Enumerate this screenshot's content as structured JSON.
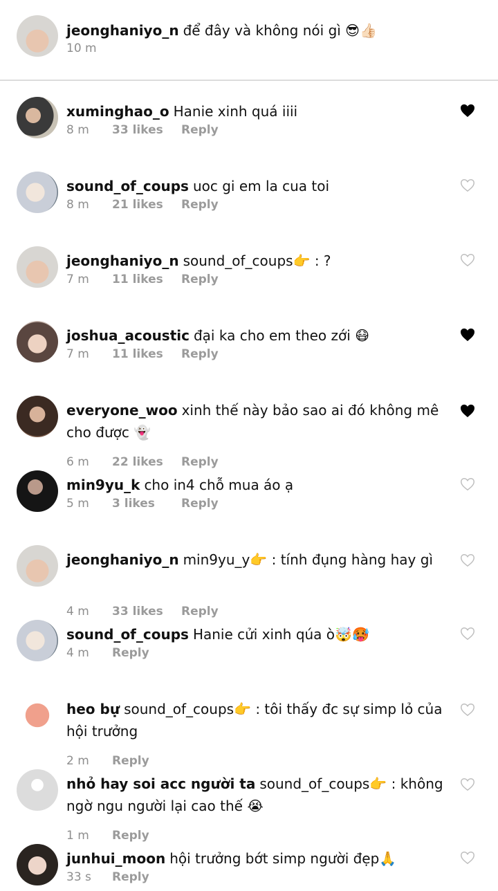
{
  "caption": {
    "username": "jeonghaniyo_n",
    "text": "để đây và không nói gì 😎👍🏻",
    "time": "10 m"
  },
  "colors": {
    "heart_filled": "#000000",
    "heart_outline": "#bdbdbd",
    "meta": "#9b9b9b",
    "divider": "#dcdcdc"
  },
  "comments": [
    {
      "username": "xuminghao_o",
      "text": "Hanie xinh quá iiii",
      "time": "8 m",
      "likes": "33 likes",
      "reply": "Reply",
      "liked": true,
      "avatar": "avatar-xuminghao"
    },
    {
      "username": "sound_of_coups",
      "text": "uoc gi em la cua toi",
      "time": "8 m",
      "likes": "21 likes",
      "reply": "Reply",
      "liked": false,
      "avatar": "avatar-sound"
    },
    {
      "username": "jeonghaniyo_n",
      "text": "sound_of_coups👉 : ?",
      "time": "7 m",
      "likes": "11 likes",
      "reply": "Reply",
      "liked": false,
      "avatar": "avatar-jeonghan"
    },
    {
      "username": "joshua_acoustic",
      "text": "đại ka cho em theo zới 😷",
      "time": "7 m",
      "likes": "11 likes",
      "reply": "Reply",
      "liked": true,
      "avatar": "avatar-joshua"
    },
    {
      "username": "everyone_woo",
      "text": "xinh thế này bảo sao ai đó không mê cho được 👻",
      "time": "6 m",
      "likes": "22 likes",
      "reply": "Reply",
      "liked": true,
      "avatar": "avatar-woo"
    },
    {
      "username": "min9yu_k",
      "text": "cho in4 chỗ mua áo ạ",
      "time": "5 m",
      "likes": "3 likes",
      "reply": "Reply",
      "liked": false,
      "avatar": "avatar-mingyu"
    },
    {
      "username": "jeonghaniyo_n",
      "text": "min9yu_y👉 : tính đụng hàng hay gì",
      "time": "4 m",
      "likes": "33 likes",
      "reply": "Reply",
      "liked": false,
      "avatar": "avatar-jeonghan"
    },
    {
      "username": "sound_of_coups",
      "text": "Hanie cửi xinh qúa ò🤯🥵",
      "time": "4 m",
      "likes": "",
      "reply": "Reply",
      "liked": false,
      "avatar": "avatar-sound"
    },
    {
      "username": "heo bự",
      "text": "sound_of_coups👉 : tôi thấy đc sự simp lỏ của hội trưởng",
      "time": "2 m",
      "likes": "",
      "reply": "Reply",
      "liked": false,
      "avatar": "avatar-pig"
    },
    {
      "username": "nhỏ hay soi acc người ta",
      "text": "sound_of_coups👉 : không ngờ ngu người lại cao thế 😭",
      "time": "1 m",
      "likes": "",
      "reply": "Reply",
      "liked": false,
      "avatar": "avatar-default"
    },
    {
      "username": "junhui_moon",
      "text": "hội trưởng bớt simp người đẹp🙏",
      "time": "33 s",
      "likes": "",
      "reply": "Reply",
      "liked": false,
      "avatar": "avatar-junhui"
    }
  ]
}
